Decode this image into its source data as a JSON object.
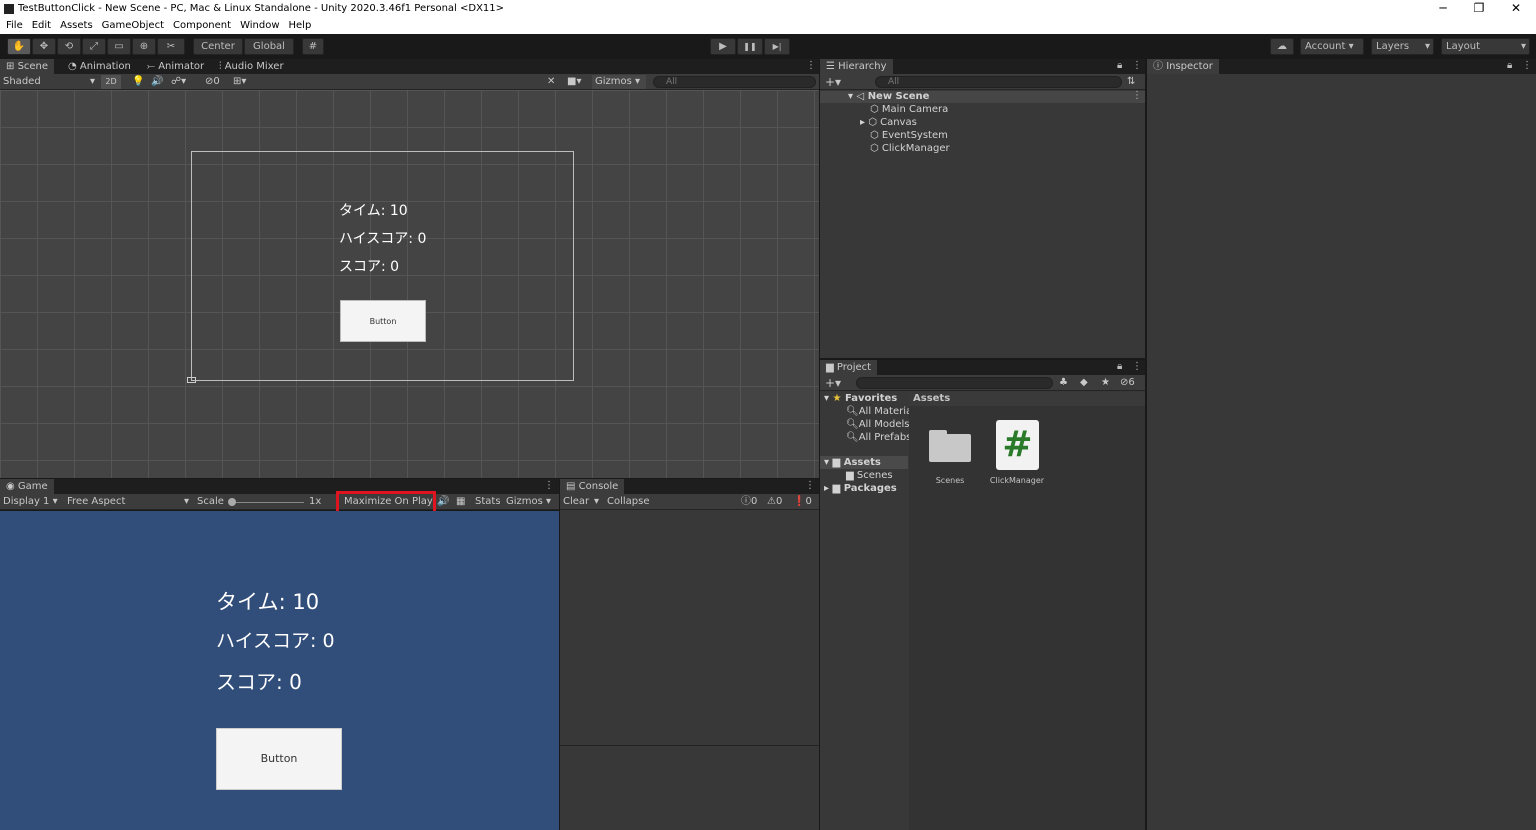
{
  "window": {
    "title": "TestButtonClick - New Scene - PC, Mac & Linux Standalone - Unity 2020.3.46f1 Personal <DX11>",
    "minimize": "─",
    "restore": "❐",
    "close": "✕"
  },
  "menu": [
    "File",
    "Edit",
    "Assets",
    "GameObject",
    "Component",
    "Window",
    "Help"
  ],
  "toolbar": {
    "center": "Center",
    "global": "Global",
    "account": "Account",
    "layers": "Layers",
    "layout": "Layout",
    "play": "▶",
    "pause": "❚❚",
    "step": "▶|"
  },
  "scene_tabs": [
    "Scene",
    "Animation",
    "Animator",
    "Audio Mixer"
  ],
  "scene_ctrl": {
    "shading": "Shaded",
    "mode2d": "2D",
    "hidden_count": "0",
    "gizmos": "Gizmos",
    "search": "All"
  },
  "scene_ui": {
    "time": "タイム: 10",
    "highscore": "ハイスコア: 0",
    "score": "スコア: 0",
    "button": "Button"
  },
  "game_tab": "Game",
  "game_ctrl": {
    "display": "Display 1",
    "aspect": "Free Aspect",
    "scale_label": "Scale",
    "scale_value": "1x",
    "maximize": "Maximize On Play",
    "stats": "Stats",
    "gizmos": "Gizmos"
  },
  "game_ui": {
    "time": "タイム: 10",
    "highscore": "ハイスコア: 0",
    "score": "スコア: 0",
    "button": "Button"
  },
  "console": {
    "tab": "Console",
    "clear": "Clear",
    "collapse": "Collapse",
    "info": "0",
    "warn": "0",
    "error": "0"
  },
  "hierarchy": {
    "tab": "Hierarchy",
    "search": "All",
    "scene": "New Scene",
    "items": [
      "Main Camera",
      "Canvas",
      "EventSystem",
      "ClickManager"
    ]
  },
  "project": {
    "tab": "Project",
    "hidden": "6",
    "favorites": "Favorites",
    "fav_items": [
      "All Materia",
      "All Models",
      "All Prefabs"
    ],
    "assets_folder": "Assets",
    "scenes": "Scenes",
    "packages": "Packages",
    "assets_header": "Assets",
    "files": [
      "Scenes",
      "ClickManager"
    ]
  },
  "inspector": {
    "tab": "Inspector"
  },
  "colors": {
    "highlight": "#e0141e",
    "game_bg": "#314d79"
  }
}
